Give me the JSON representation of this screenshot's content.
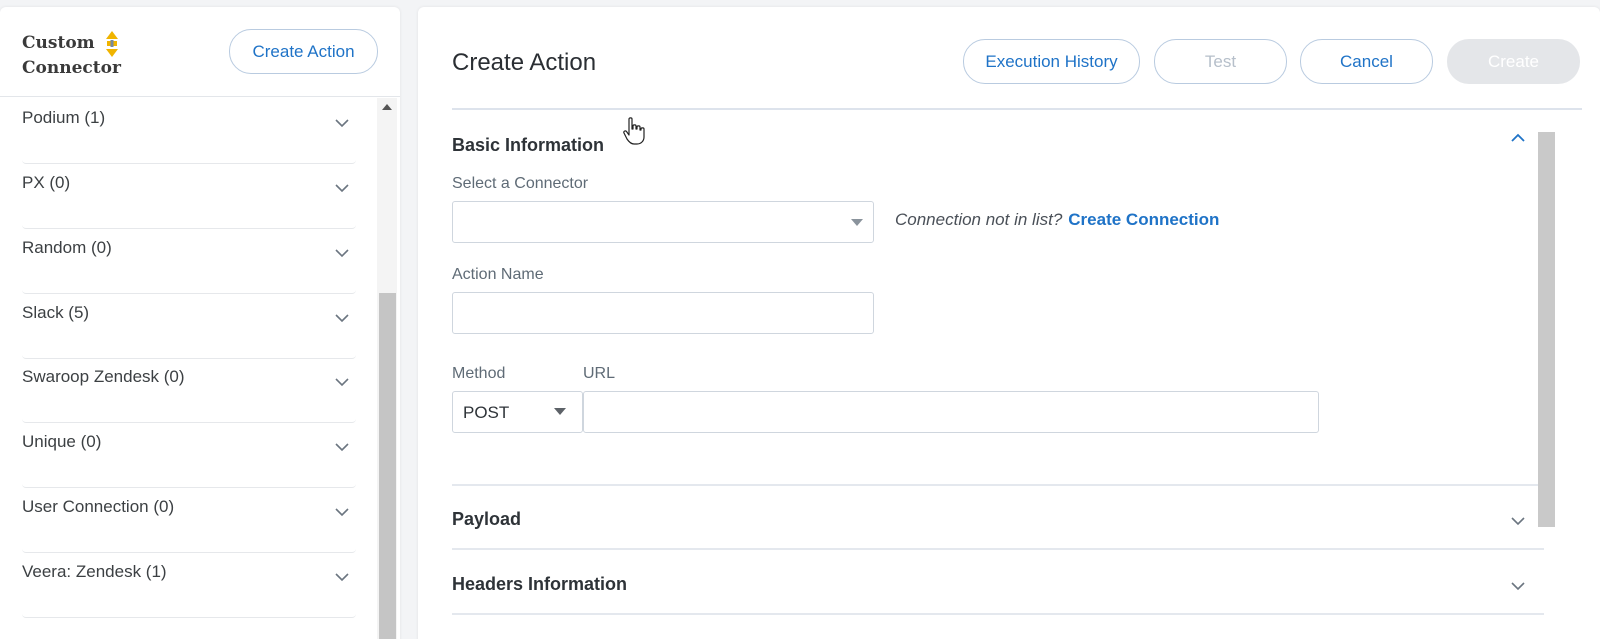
{
  "left": {
    "brand_line1": "Custom",
    "brand_line2": "Connector",
    "create_action_label": "Create Action",
    "items": [
      {
        "label": "Podium (1)"
      },
      {
        "label": "PX (0)"
      },
      {
        "label": "Random (0)"
      },
      {
        "label": "Slack (5)"
      },
      {
        "label": "Swaroop Zendesk (0)"
      },
      {
        "label": "Unique (0)"
      },
      {
        "label": "User Connection (0)"
      },
      {
        "label": "Veera: Zendesk (1)"
      }
    ]
  },
  "main": {
    "title": "Create Action",
    "buttons": {
      "execution_history": "Execution History",
      "test": "Test",
      "cancel": "Cancel",
      "create": "Create"
    },
    "basic_information": {
      "title": "Basic Information",
      "connector_label": "Select a Connector",
      "connector_value": "",
      "connection_hint": "Connection not in list?",
      "create_connection_link": "Create Connection",
      "action_name_label": "Action Name",
      "action_name_value": "",
      "method_label": "Method",
      "method_value": "POST",
      "url_label": "URL",
      "url_value": ""
    },
    "payload_title": "Payload",
    "headers_title": "Headers Information"
  },
  "colors": {
    "accent": "#1f73c7",
    "disabled_button": "#e4e6e9",
    "border": "#cfd6de"
  },
  "icons": [
    "chevron-down-icon",
    "chevron-up-icon",
    "dropdown-caret-icon",
    "hand-cursor-icon",
    "connector-logo-icon"
  ]
}
